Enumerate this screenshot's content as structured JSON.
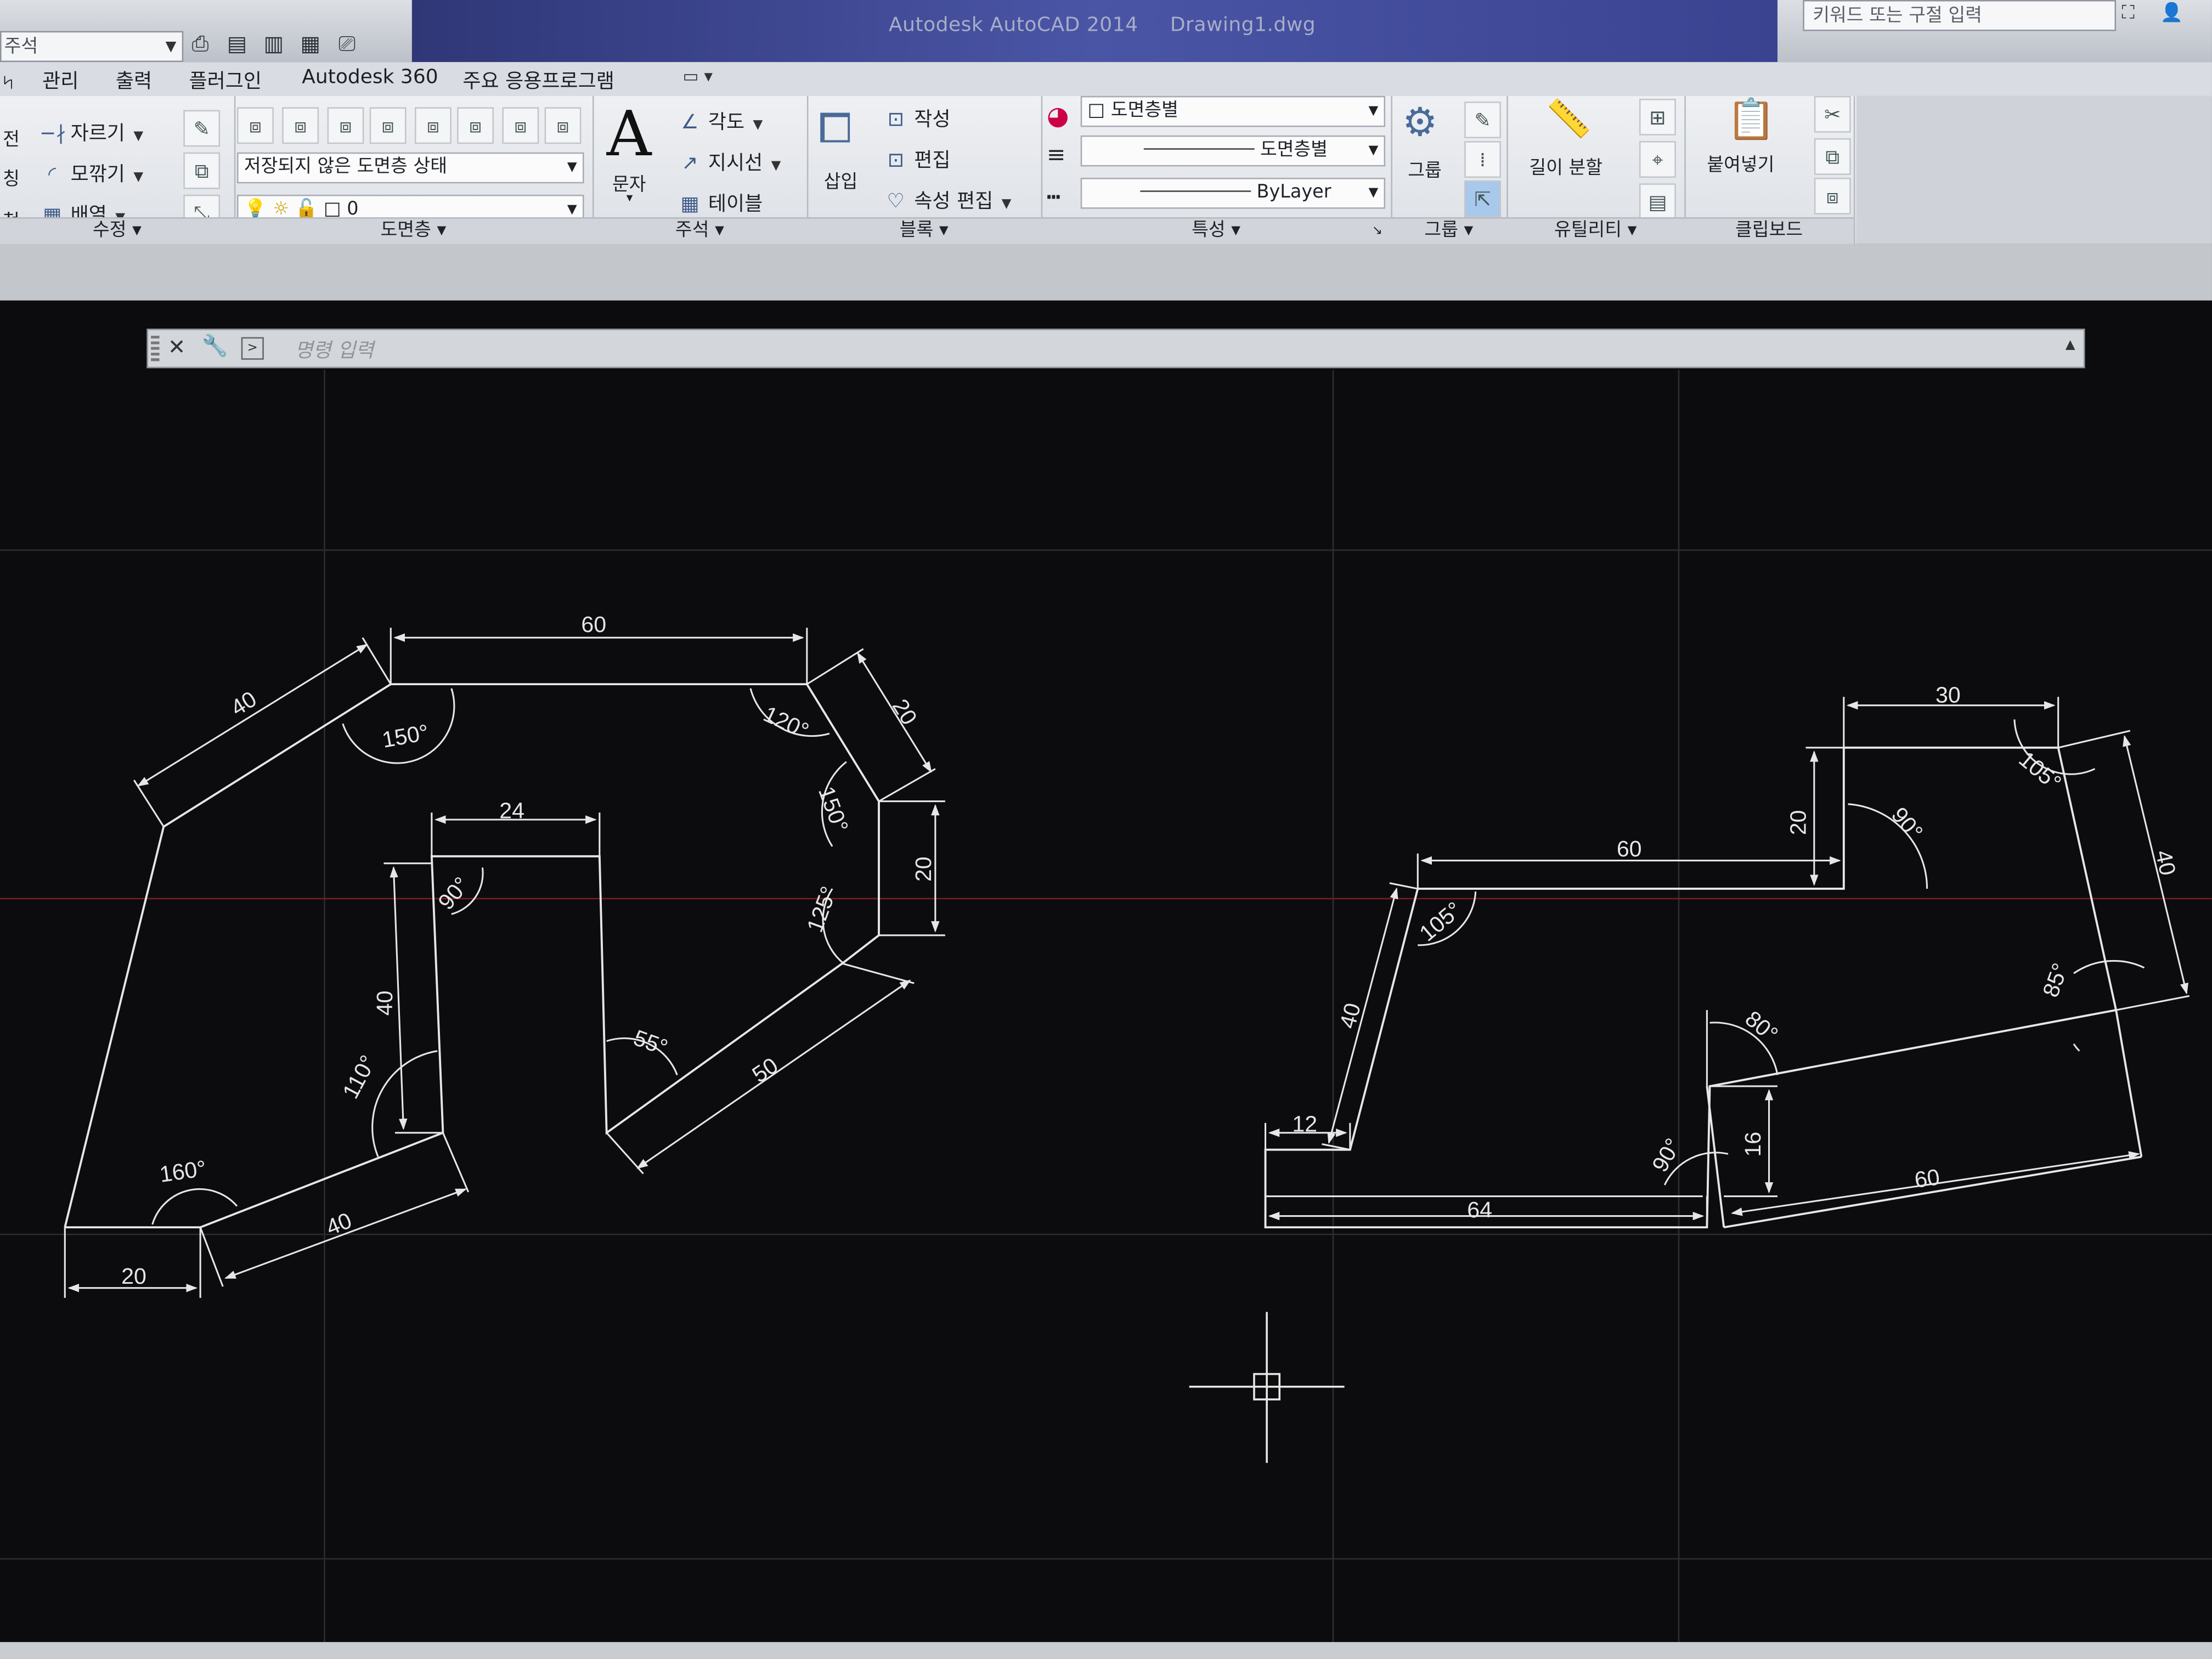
{
  "title_bar": {
    "workspace": "주석",
    "app_name": "Autodesk AutoCAD 2014",
    "file_name": "Drawing1.dwg",
    "search_placeholder": "키워드 또는 구절 입력"
  },
  "menu_tabs": [
    "관리",
    "출력",
    "플러그인",
    "Autodesk 360",
    "주요 응용프로그램"
  ],
  "ribbon": {
    "modify": {
      "title": "수정",
      "trim": "자르기",
      "fillet": "모깎기",
      "array": "배열",
      "row_labels": [
        "전",
        "칭",
        "척"
      ]
    },
    "layers": {
      "title": "도면층",
      "layer_state": "저장되지 않은 도면층 상태",
      "current_layer": "0"
    },
    "annotation": {
      "title": "주석",
      "text": "문자",
      "angular": "각도",
      "leader": "지시선",
      "table": "테이블"
    },
    "block": {
      "title": "블록",
      "insert": "삽입",
      "create": "작성",
      "edit": "편집",
      "edit_attributes": "속성 편집"
    },
    "properties": {
      "title": "특성",
      "color": "도면층별",
      "linetype": "도면층별",
      "lineweight": "ByLayer"
    },
    "groups": {
      "title": "그룹",
      "group": "그룹"
    },
    "utilities": {
      "title": "유틸리티",
      "measure": "길이 분할"
    },
    "clipboard": {
      "title": "클립보드",
      "paste": "붙여넣기"
    }
  },
  "command_line": {
    "placeholder": "명령 입력"
  },
  "drawing": {
    "left_shape": {
      "dims": [
        "60",
        "40",
        "20",
        "24",
        "40",
        "20",
        "50",
        "40",
        "20"
      ],
      "angles": [
        "150°",
        "120°",
        "150°",
        "90°",
        "125°",
        "55°",
        "110°",
        "160°"
      ]
    },
    "right_shape": {
      "dims": [
        "30",
        "20",
        "60",
        "40",
        "40",
        "12",
        "16",
        "64",
        "60"
      ],
      "angles": [
        "105°",
        "90°",
        "105°",
        "85°",
        "80°",
        "90°"
      ]
    }
  },
  "colors": {
    "canvas": "#0c0c0e",
    "drawing_line": "#e6e6e6",
    "grid": "#2b2d30",
    "x_axis": "#7a1e1e",
    "title_band": "#3a4390"
  }
}
